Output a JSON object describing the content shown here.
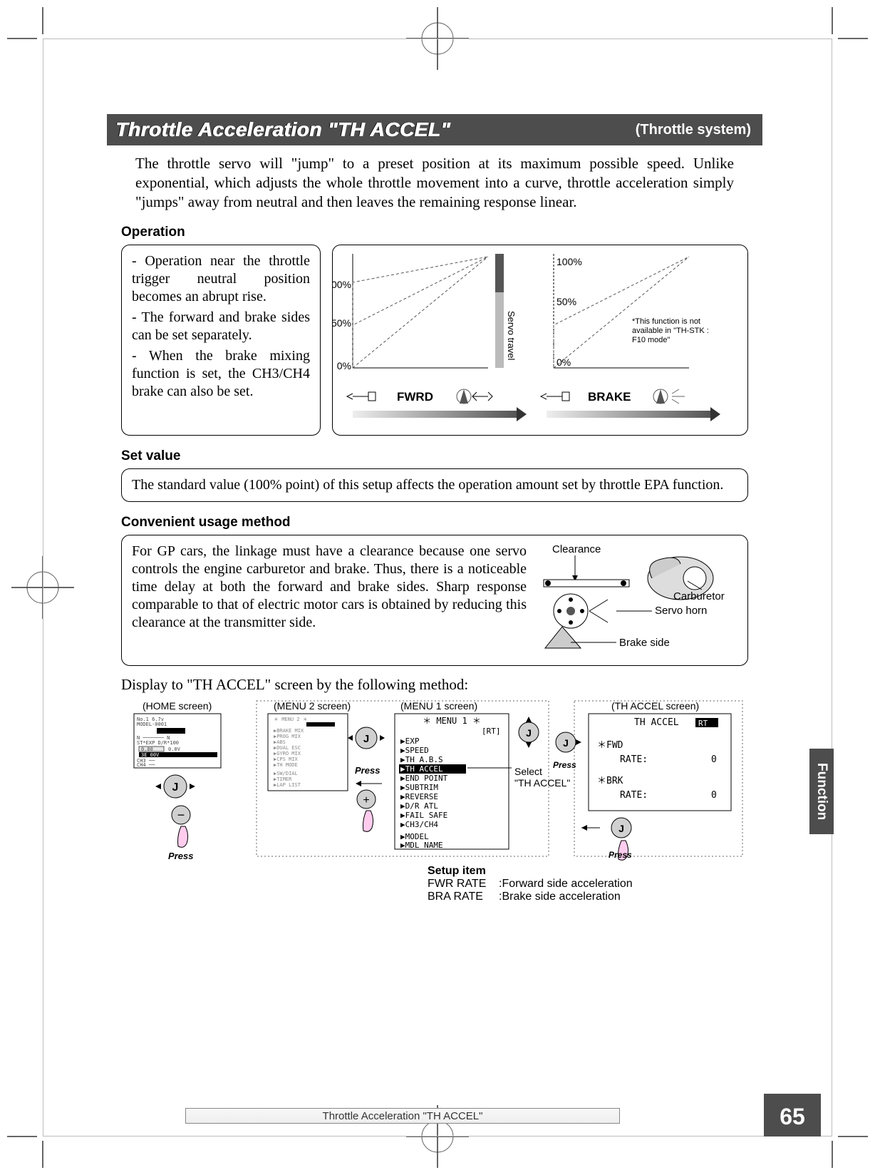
{
  "title": {
    "main": "Throttle Acceleration  \"TH ACCEL\"",
    "sub": "(Throttle system)"
  },
  "intro": "The throttle servo will \"jump\" to a preset position at its maximum possible speed. Unlike exponential, which adjusts the whole throttle movement into a curve, throttle acceleration simply \"jumps\" away from neutral and then leaves the remaining response linear.",
  "operation": {
    "heading": "Operation",
    "items": [
      "- Operation near the throttle trigger neutral position becomes an abrupt rise.",
      "- The forward and brake sides can be set separately.",
      "- When the brake mixing function is set, the CH3/CH4 brake can also be set."
    ]
  },
  "graph": {
    "fwrd_label": "FWRD",
    "brake_label": "BRAKE",
    "servo_travel_label": "Servo travel",
    "pct_100": "100%",
    "pct_50": "50%",
    "pct_0": "0%",
    "note": "*This function is not available in \"TH-STK : F10 mode\""
  },
  "set_value": {
    "heading": "Set value",
    "text": "The standard value (100% point) of this setup affects the operation amount set by throttle EPA function."
  },
  "usage": {
    "heading": "Convenient usage method",
    "text": "For GP cars, the linkage must have a clearance because one servo controls the engine carburetor and brake. Thus, there is a noticeable time delay at both the forward and brake sides. Sharp response comparable to that of electric motor cars is obtained by reducing this clearance at the transmitter side.",
    "labels": {
      "clearance": "Clearance",
      "carburetor": "Carburetor",
      "servo_horn": "Servo horn",
      "brake_side": "Brake side"
    }
  },
  "nav": {
    "intro": "Display to \"TH ACCEL\" screen by the following method:",
    "home_label": "(HOME screen)",
    "menu2_label": "(MENU 2 screen)",
    "menu1_label": "(MENU 1 screen)",
    "accel_label": "(TH ACCEL screen)",
    "press": "Press",
    "select_text": "Select \"TH ACCEL\"",
    "jog_j": "J",
    "btn_plus": "+",
    "btn_minus": "−",
    "menu1_items": [
      "EXP",
      "SPEED",
      "TH A.B.S",
      "TH ACCEL",
      "END POINT",
      "SUBTRIM",
      "REVERSE",
      "D/R ATL",
      "FAIL SAFE",
      "CH3/CH4",
      "",
      "MODEL",
      "MDL NAME"
    ],
    "menu1_title": "＊ MENU 1 ＊",
    "menu1_rt": "[RT]",
    "accel_screen": {
      "title": "TH ACCEL",
      "rt": "RT",
      "fwd_label": "＊FWD",
      "brk_label": "＊BRK",
      "rate_label": "RATE:",
      "rate_value": "0"
    }
  },
  "setup": {
    "heading": "Setup item",
    "rows": [
      {
        "key": "FWR RATE",
        "desc": ":Forward side acceleration"
      },
      {
        "key": "BRA RATE",
        "desc": ":Brake side acceleration"
      }
    ]
  },
  "footer": "Throttle Acceleration  \"TH ACCEL\"",
  "page_number": "65",
  "side_tab": "Function"
}
